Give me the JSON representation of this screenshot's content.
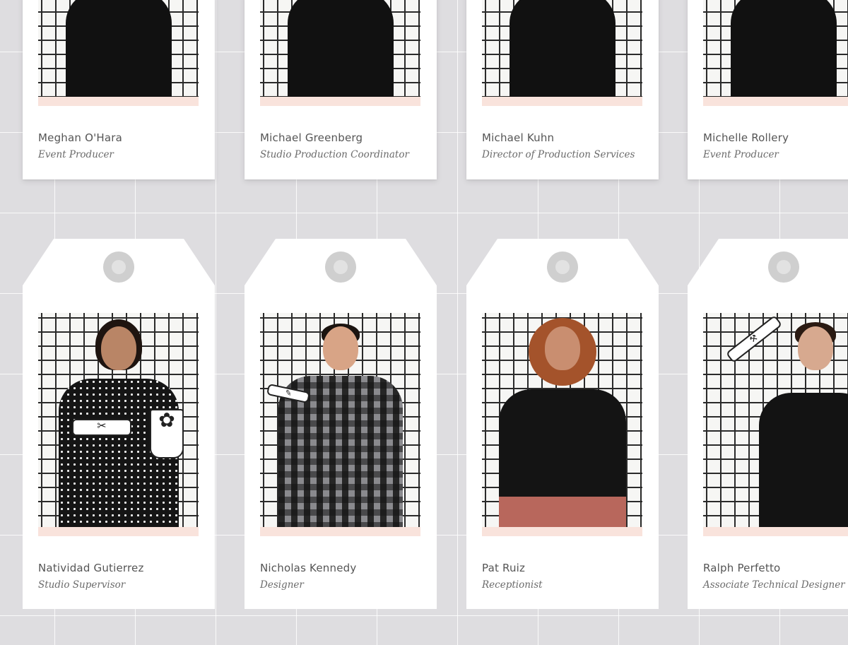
{
  "row1": [
    {
      "name": "Meghan O'Hara",
      "role": "Event Producer"
    },
    {
      "name": "Michael Greenberg",
      "role": "Studio Production Coordinator"
    },
    {
      "name": "Michael Kuhn",
      "role": "Director of Production Services"
    },
    {
      "name": "Michelle Rollery",
      "role": "Event Producer"
    }
  ],
  "row2": [
    {
      "name": "Natividad Gutierrez",
      "role": "Studio Supervisor",
      "props": [
        "scissors-icon",
        "potted-plant-icon"
      ]
    },
    {
      "name": "Nicholas Kennedy",
      "role": "Designer",
      "props": [
        "pencil-icon"
      ]
    },
    {
      "name": "Pat Ruiz",
      "role": "Receptionist",
      "props": []
    },
    {
      "name": "Ralph Perfetto",
      "role": "Associate Technical Designer",
      "props": [
        "hammer-icon"
      ]
    }
  ],
  "colors": {
    "background": "#dedde0",
    "card": "#ffffff",
    "photo_stripe": "#f9e3dc",
    "tag_hole": "#cfcfcf"
  }
}
